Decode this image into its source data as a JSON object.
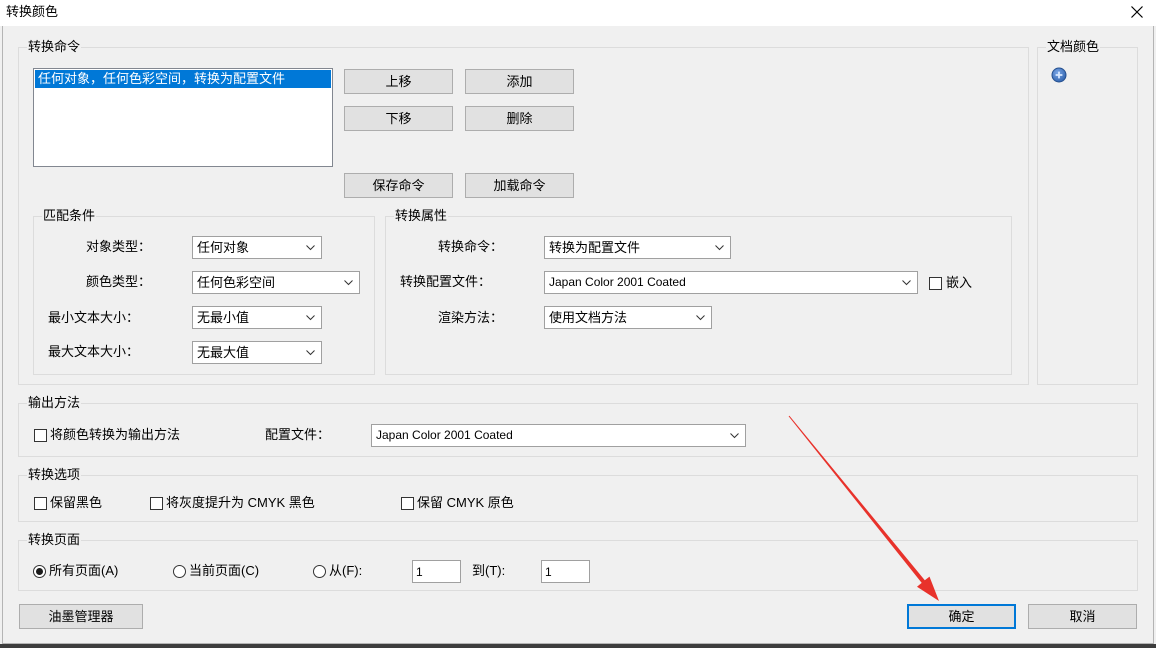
{
  "window": {
    "title": "转换颜色",
    "close_icon": "close-icon"
  },
  "conversion_commands": {
    "label": "转换命令",
    "list_items": [
      {
        "text": "任何对象，任何色彩空间，转换为配置文件",
        "selected": true
      }
    ],
    "buttons": {
      "move_up": "上移",
      "add": "添加",
      "move_down": "下移",
      "delete": "删除",
      "save": "保存命令",
      "load": "加载命令"
    },
    "matching_criteria": {
      "label": "匹配条件",
      "object_type": {
        "label": "对象类型：",
        "value": "任何对象"
      },
      "color_type": {
        "label": "颜色类型：",
        "value": "任何色彩空间"
      },
      "min_text_size": {
        "label": "最小文本大小：",
        "value": "无最小值"
      },
      "max_text_size": {
        "label": "最大文本大小：",
        "value": "无最大值"
      }
    },
    "conversion_attributes": {
      "label": "转换属性",
      "command": {
        "label": "转换命令：",
        "value": "转换为配置文件"
      },
      "profile": {
        "label": "转换配置文件：",
        "value": "Japan Color 2001 Coated"
      },
      "embed": {
        "label": "嵌入",
        "checked": false
      },
      "rendering_intent": {
        "label": "渲染方法：",
        "value": "使用文档方法"
      }
    }
  },
  "document_colors": {
    "label": "文档颜色",
    "expand_icon": "plus-circle-icon"
  },
  "output_intent": {
    "label": "输出方法",
    "convert_to_output": {
      "label": "将颜色转换为输出方法",
      "checked": false
    },
    "profile": {
      "label": "配置文件：",
      "value": "Japan Color 2001 Coated"
    }
  },
  "conversion_options": {
    "label": "转换选项",
    "preserve_black": {
      "label": "保留黑色",
      "checked": false
    },
    "promote_gray": {
      "label": "将灰度提升为 CMYK 黑色",
      "checked": false
    },
    "preserve_cmyk": {
      "label": "保留 CMYK 原色",
      "checked": false
    }
  },
  "pages": {
    "label": "转换页面",
    "all": {
      "label": "所有页面(A)",
      "selected": true
    },
    "current": {
      "label": "当前页面(C)",
      "selected": false
    },
    "range": {
      "label": "从(F):",
      "selected": false
    },
    "from_value": "1",
    "to_label": "到(T):",
    "to_value": "1"
  },
  "footer": {
    "ink_manager": "油墨管理器",
    "ok": "确定",
    "cancel": "取消"
  },
  "colors": {
    "selection": "#0078d7",
    "default_button_border": "#0078d7",
    "annotation_arrow": "#e8322b"
  }
}
